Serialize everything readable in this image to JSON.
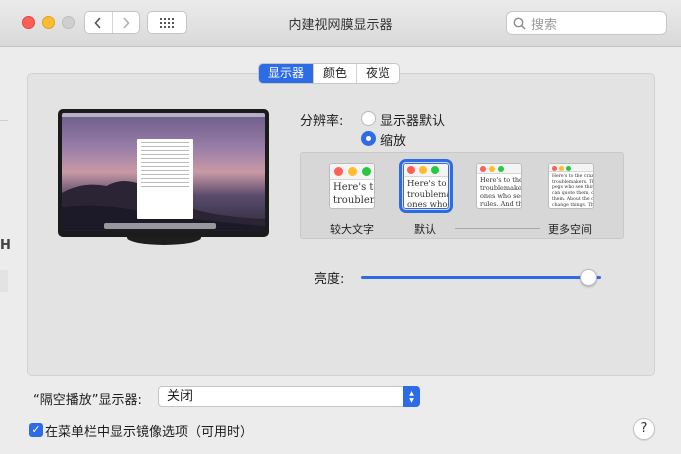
{
  "window": {
    "title": "内建视网膜显示器",
    "search_placeholder": "搜索",
    "nav_back_icon": "chevron-left-icon",
    "nav_forward_icon": "chevron-right-icon",
    "grid_icon": "show-all-grid-icon"
  },
  "sidebar_edge": {
    "glyph": "H"
  },
  "tabs": [
    {
      "label": "显示器",
      "active": true
    },
    {
      "label": "颜色",
      "active": false
    },
    {
      "label": "夜览",
      "active": false
    }
  ],
  "resolution": {
    "label": "分辨率:",
    "options": [
      {
        "label": "显示器默认",
        "selected": false
      },
      {
        "label": "缩放",
        "selected": true
      }
    ]
  },
  "scaling": {
    "options": [
      {
        "label": "较大文字",
        "preview": "Here's to\ntroublem",
        "selected": false
      },
      {
        "label": "默认",
        "preview": "Here's to t\ntroublema\nones who",
        "selected": true
      },
      {
        "label": "",
        "preview": "Here's to the cr\ntroublemakers.\nones who see th\nrules. And they",
        "selected": false
      },
      {
        "label": "更多空间",
        "preview": "Here's to the crazy ones\ntroublemakers. The round\npegs who see things diffe\ncan quote them, disagree\nthem. About the only thing\nchange things. They push",
        "selected": false
      }
    ]
  },
  "brightness": {
    "label": "亮度:",
    "value": 0.95
  },
  "airplay": {
    "label": "“隔空播放”显示器:",
    "selected": "关闭"
  },
  "mirror_option": {
    "label": "在菜单栏中显示镜像选项（可用时）",
    "checked": true
  },
  "help": {
    "label": "?"
  },
  "colors": {
    "accent": "#2e6ce6",
    "close": "#fe5f57",
    "minimize": "#febc2e",
    "inactive": "#cfcfcf"
  }
}
